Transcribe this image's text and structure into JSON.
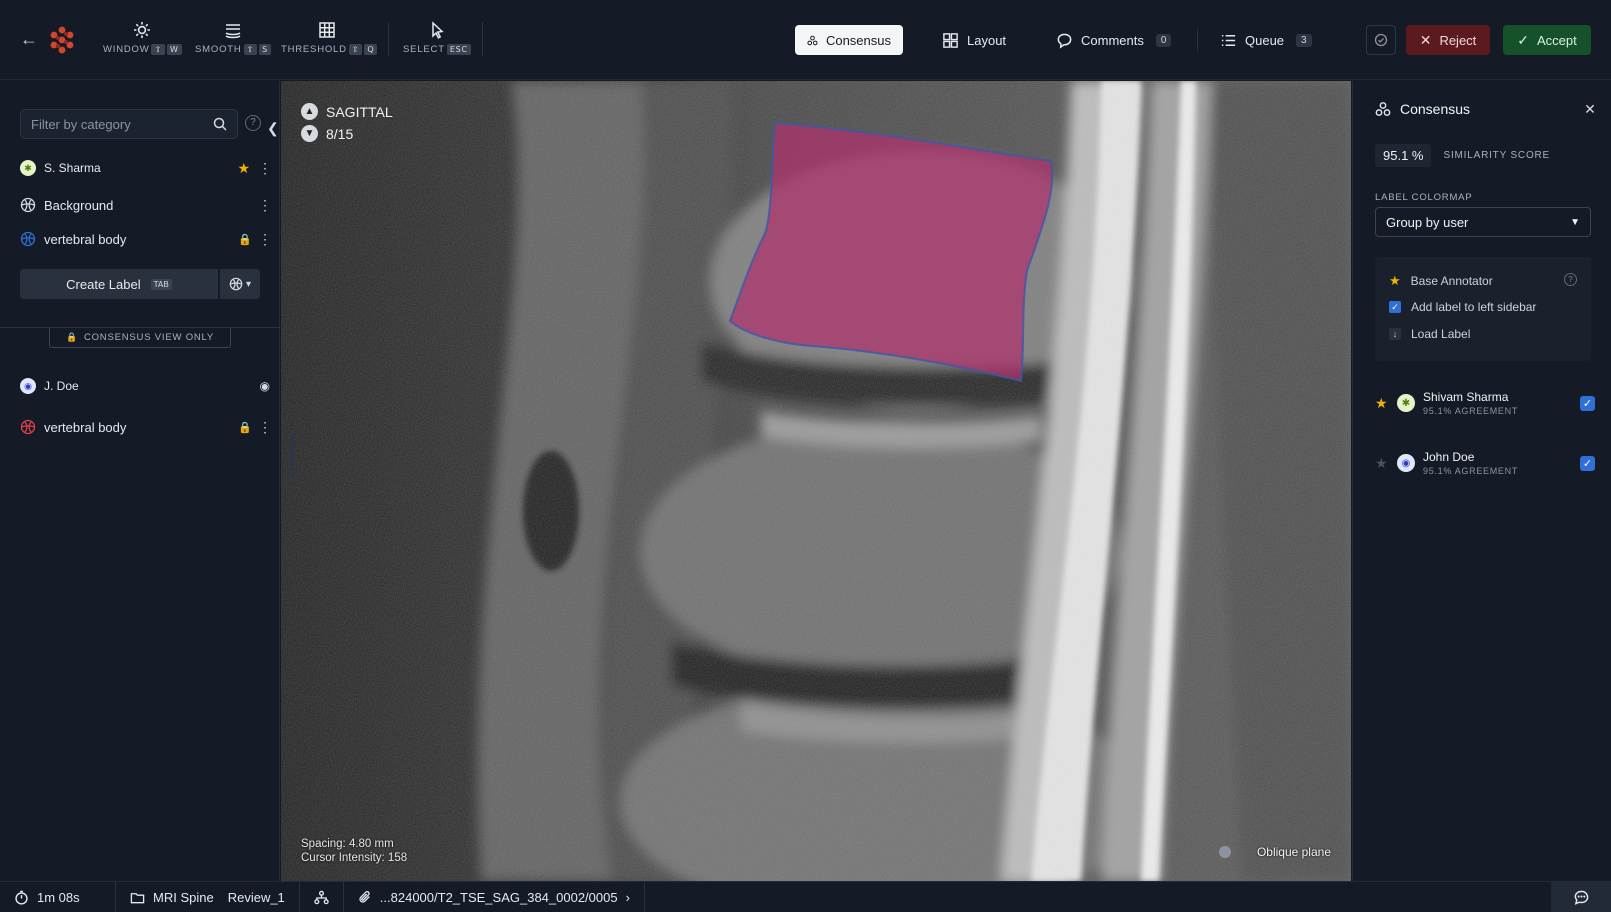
{
  "toolbar": {
    "tools": [
      {
        "label": "WINDOW",
        "keys": [
          "⇧",
          "W"
        ],
        "icon": "sun-icon"
      },
      {
        "label": "SMOOTH",
        "keys": [
          "⇧",
          "S"
        ],
        "icon": "layers-icon"
      },
      {
        "label": "THRESHOLD",
        "keys": [
          "⇧",
          "Q"
        ],
        "icon": "grid-icon"
      },
      {
        "label": "SELECT",
        "keys": [
          "ESC"
        ],
        "icon": "cursor-icon"
      }
    ],
    "nav": {
      "consensus": "Consensus",
      "layout": "Layout",
      "comments": "Comments",
      "comments_count": "0",
      "queue": "Queue",
      "queue_count": "3"
    },
    "reject": "Reject",
    "accept": "Accept"
  },
  "left": {
    "filter_placeholder": "Filter by category",
    "user1": {
      "name": "S. Sharma",
      "labels": [
        "Background",
        "vertebral body"
      ]
    },
    "create_label": "Create Label",
    "create_key": "TAB",
    "consensus_only": "CONSENSUS VIEW ONLY",
    "user2": {
      "name": "J. Doe",
      "labels": [
        "vertebral body"
      ]
    }
  },
  "viewer": {
    "plane": "SAGITTAL",
    "slice": "8/15",
    "spacing": "Spacing: 4.80 mm",
    "cursor_intensity": "Cursor Intensity: 158",
    "oblique": "Oblique plane"
  },
  "right": {
    "title": "Consensus",
    "score": "95.1 %",
    "score_label": "SIMILARITY SCORE",
    "colormap_label": "LABEL COLORMAP",
    "colormap_value": "Group by user",
    "options": [
      "Base Annotator",
      "Add label to left sidebar",
      "Load Label"
    ],
    "users": [
      {
        "name": "Shivam Sharma",
        "agreement": "95.1% AGREEMENT",
        "base": true
      },
      {
        "name": "John Doe",
        "agreement": "95.1% AGREEMENT",
        "base": false
      }
    ]
  },
  "bottom": {
    "timer": "1m 08s",
    "project": "MRI Spine",
    "review": "Review_1",
    "file": "...824000/T2_TSE_SAG_384_0002/0005"
  },
  "colors": {
    "accent": "#2f6fd6",
    "segmentation": "#b0306e",
    "reject": "#5b1a1f",
    "accept": "#15522c",
    "star": "#f0b400"
  }
}
